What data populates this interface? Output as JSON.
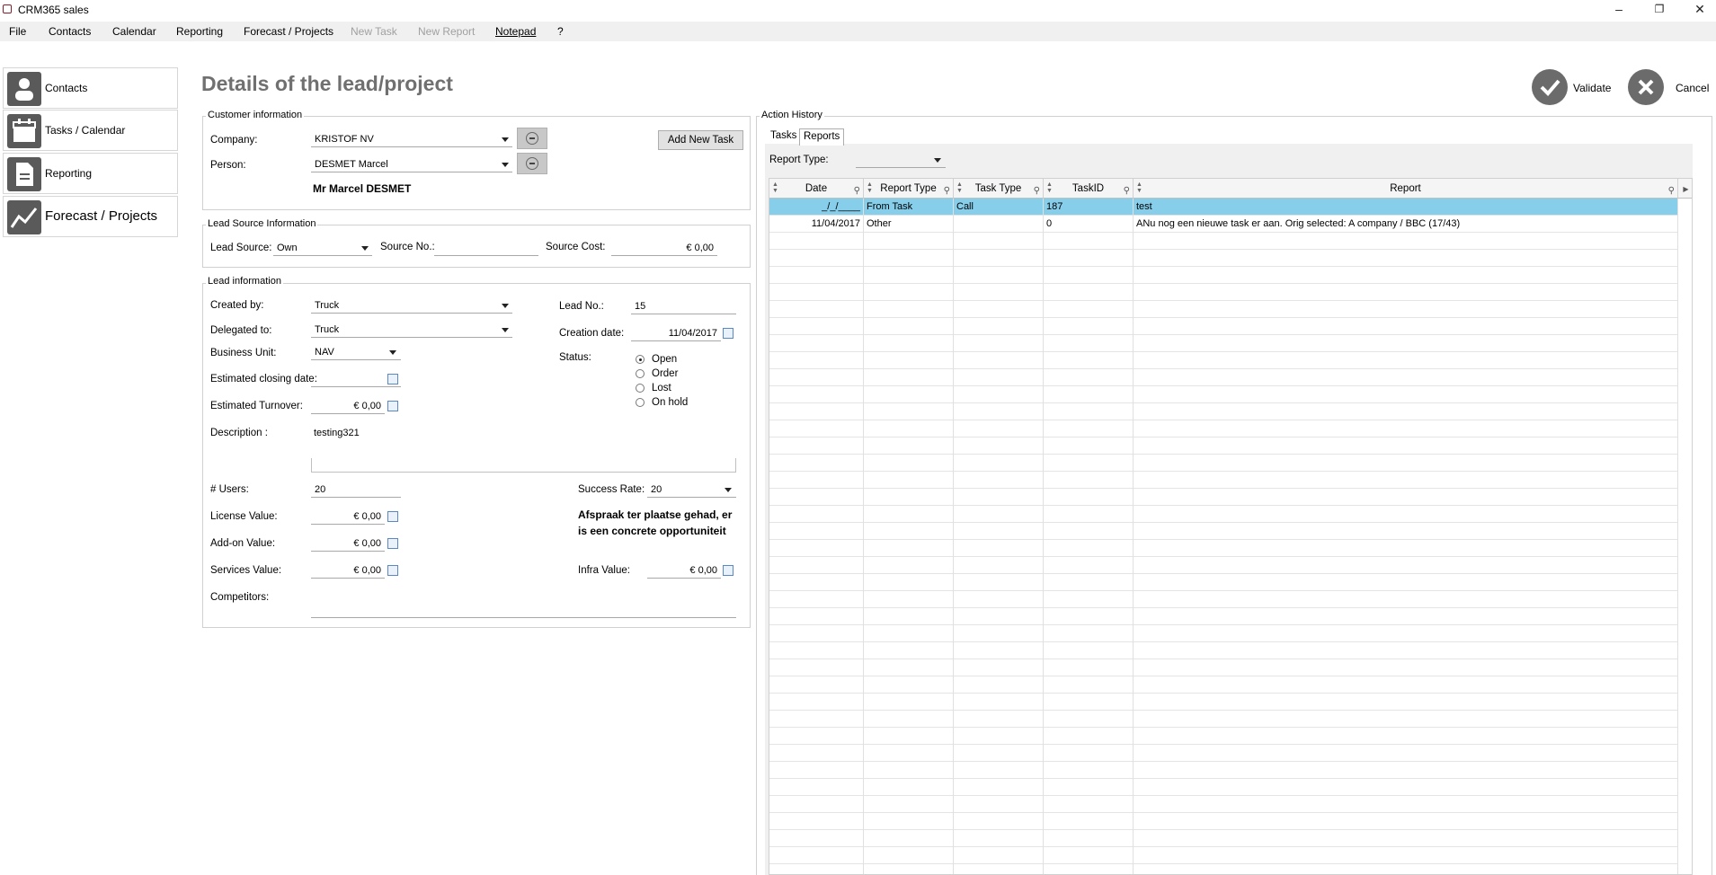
{
  "window": {
    "title": "CRM365 sales",
    "minimize": "–",
    "restore": "❐",
    "close": "✕"
  },
  "menu": [
    "File",
    "Contacts",
    "Calendar",
    "Reporting",
    "Forecast / Projects",
    "New Task",
    "New Report",
    "Notepad",
    "?"
  ],
  "nav": {
    "contacts": "Contacts",
    "tasks": "Tasks / Calendar",
    "reporting": "Reporting",
    "forecast": "Forecast / Projects"
  },
  "header": {
    "title": "Details of  the lead/project",
    "validate": "Validate",
    "cancel": "Cancel"
  },
  "customer": {
    "group": "Customer information",
    "company_label": "Company:",
    "company": "KRISTOF NV",
    "person_label": "Person:",
    "person": "DESMET Marcel",
    "full_name": "Mr Marcel DESMET",
    "add_task": "Add New Task"
  },
  "source": {
    "group": "Lead Source Information",
    "source_label": "Lead Source:",
    "source": "Own",
    "no_label": "Source No.:",
    "no": "",
    "cost_label": "Source Cost:",
    "cost": "€ 0,00"
  },
  "lead": {
    "group": "Lead information",
    "created_label": "Created by:",
    "created": "Truck",
    "delegated_label": "Delegated to:",
    "delegated": "Truck",
    "bu_label": "Business Unit:",
    "bu": "NAV",
    "closing_label": "Estimated closing date:",
    "closing": "",
    "turnover_label": "Estimated Turnover:",
    "turnover": "€ 0,00",
    "desc_label": "Description :",
    "desc": "testing321",
    "leadno_label": "Lead No.:",
    "leadno": "15",
    "creation_label": "Creation date:",
    "creation": "11/04/2017",
    "status_label": "Status:",
    "status_options": [
      "Open",
      "Order",
      "Lost",
      "On hold"
    ],
    "status_selected": "Open",
    "users_label": "# Users:",
    "users": "20",
    "license_label": "License Value:",
    "license": "€ 0,00",
    "addon_label": "Add-on Value:",
    "addon": "€ 0,00",
    "services_label": "Services Value:",
    "services": "€ 0,00",
    "competitors_label": "Competitors:",
    "competitors": "",
    "success_label": "Success Rate:",
    "success": "20",
    "success_note": "Afspraak ter plaatse gehad, er is een concrete opportuniteit",
    "infra_label": "Infra Value:",
    "infra": "€ 0,00"
  },
  "history": {
    "group": "Action History",
    "tabs": [
      "Tasks",
      "Reports"
    ],
    "active_tab": "Reports",
    "report_type_label": "Report Type:",
    "report_type": "",
    "columns": [
      "Date",
      "Report Type",
      "Task Type",
      "TaskID",
      "Report"
    ],
    "rows": [
      [
        "_/_/____",
        "From Task",
        "Call",
        "187",
        "test"
      ],
      [
        "11/04/2017",
        "Other",
        "",
        "0",
        "ANu nog een nieuwe task er aan. Orig selected: A company / BBC (17/43)"
      ]
    ]
  }
}
